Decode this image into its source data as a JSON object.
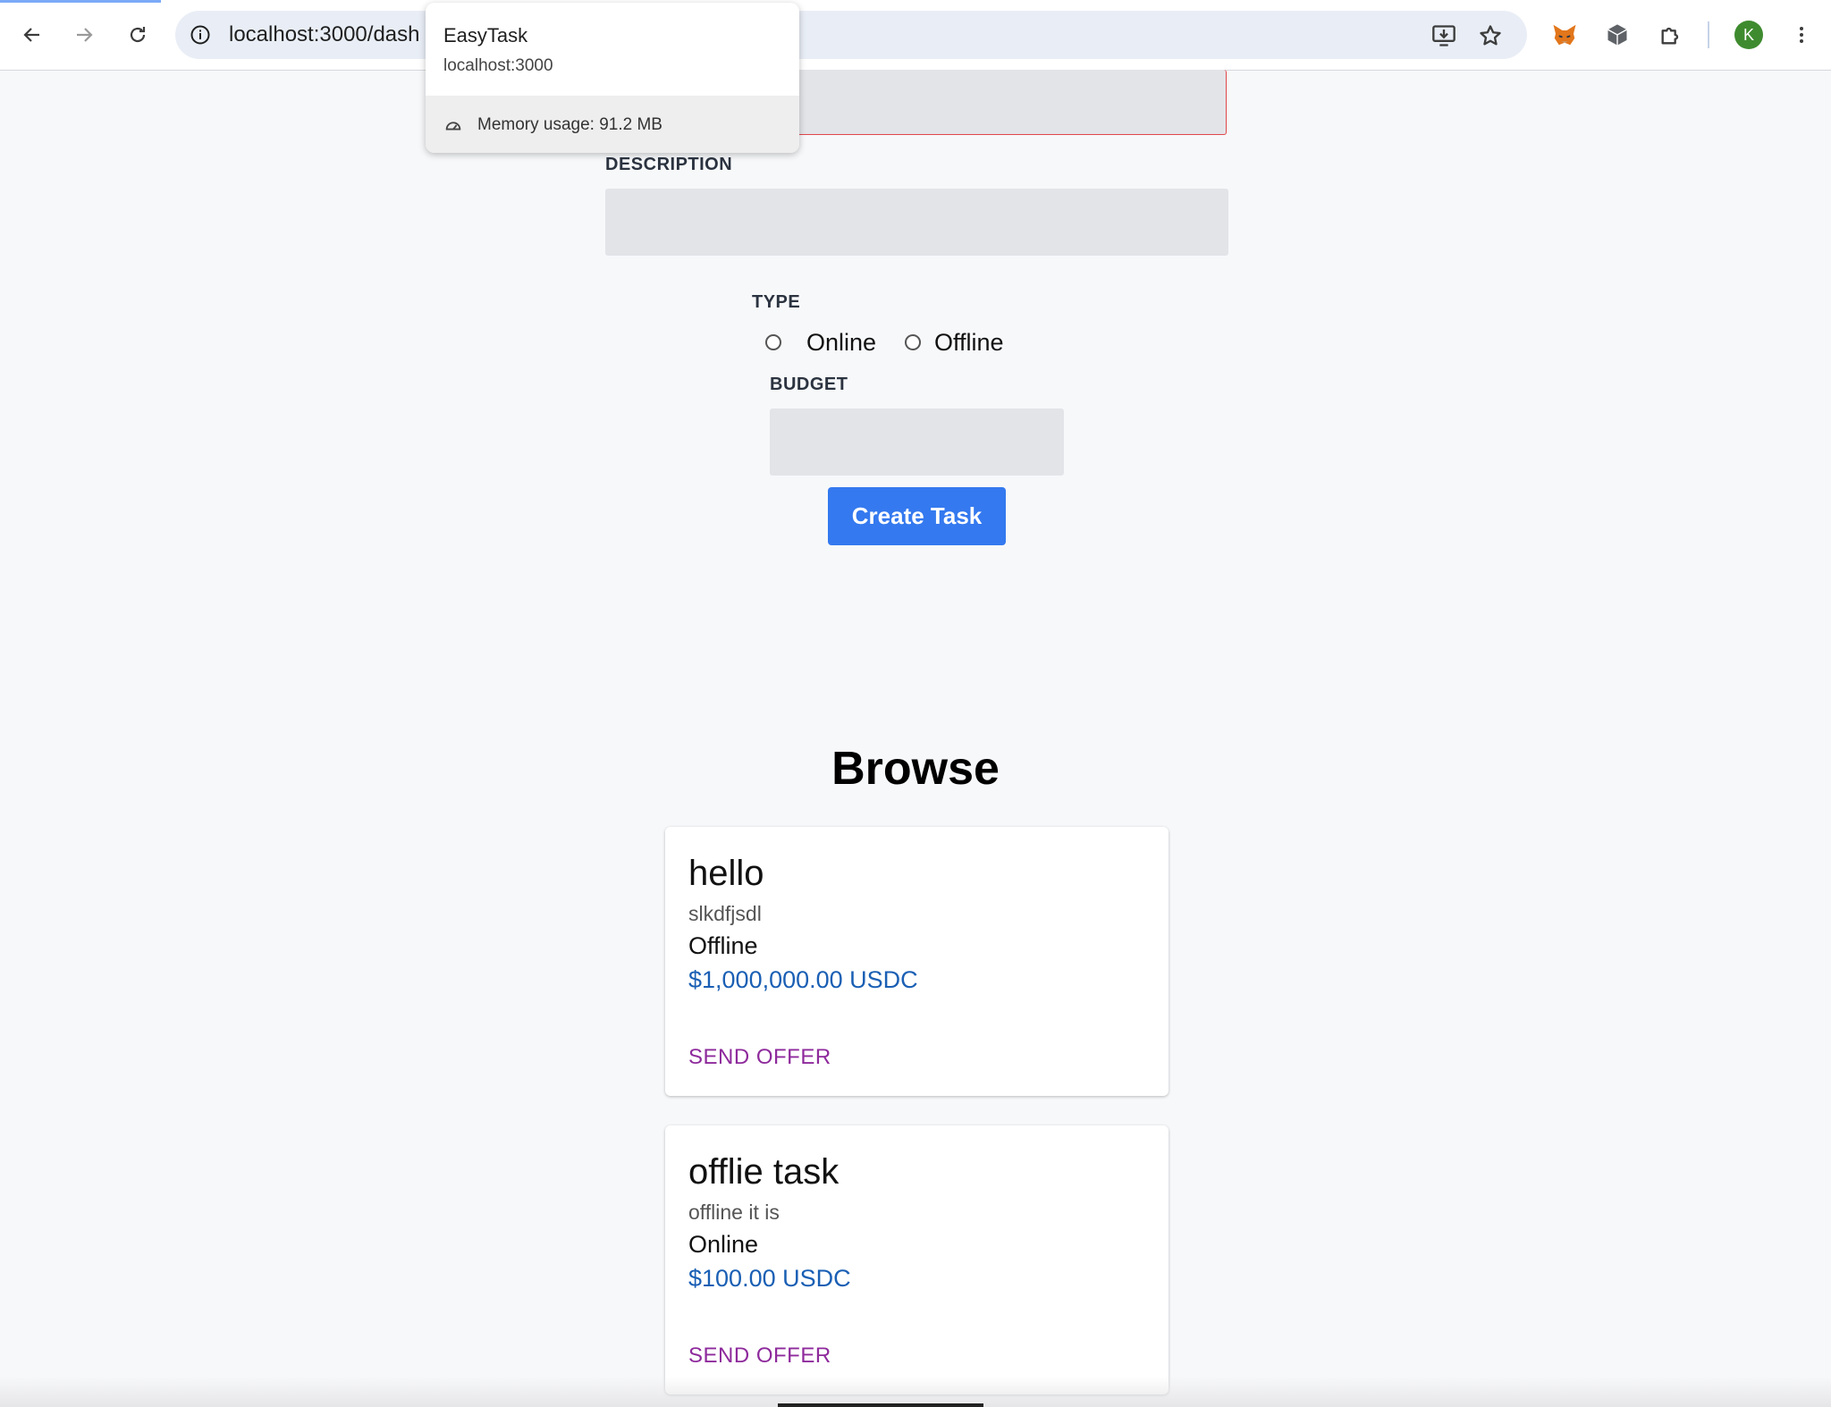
{
  "browser": {
    "url": "localhost:3000/dash",
    "tab_hover": {
      "title": "EasyTask",
      "host": "localhost:3000",
      "memory": "Memory usage: 91.2 MB"
    },
    "profile_initial": "K",
    "icons": {
      "back": "arrow-left-icon",
      "forward": "arrow-right-icon",
      "reload": "reload-icon",
      "info": "info-icon",
      "install": "install-app-icon",
      "bookmark": "star-icon",
      "metamask": "fox-extension-icon",
      "cube": "cube-extension-icon",
      "extensions": "puzzle-icon",
      "menu": "kebab-menu-icon"
    }
  },
  "form": {
    "title_value": "",
    "description_label": "DESCRIPTION",
    "description_value": "",
    "type_label": "TYPE",
    "type_options": [
      "Online",
      "Offline"
    ],
    "budget_label": "BUDGET",
    "budget_value": "",
    "submit_label": "Create Task"
  },
  "browse": {
    "title": "Browse",
    "tasks": [
      {
        "title": "hello",
        "description": "slkdfjsdl",
        "type": "Offline",
        "budget": "$1,000,000.00 USDC",
        "action": "SEND OFFER"
      },
      {
        "title": "offlie task",
        "description": "offline it is",
        "type": "Online",
        "budget": "$100.00 USDC",
        "action": "SEND OFFER"
      }
    ]
  },
  "colors": {
    "accent": "#3479ef",
    "error_border": "#e0474c",
    "budget_text": "#1a5fb4",
    "offer_text": "#8e2a9c"
  }
}
